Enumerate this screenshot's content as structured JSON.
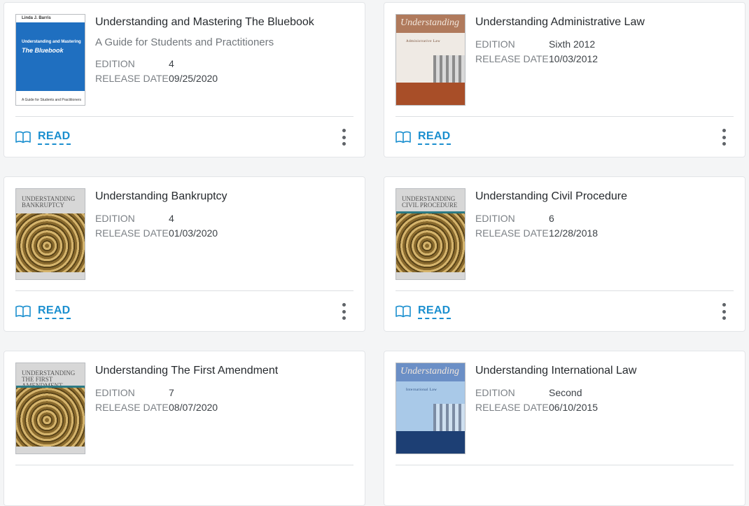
{
  "labels": {
    "edition": "EDITION",
    "release_date": "RELEASE DATE",
    "read": "READ"
  },
  "accent_color": "#1b8fcf",
  "books": [
    {
      "title": "Understanding and Mastering The Bluebook",
      "subtitle": "A Guide for Students and Practitioners",
      "edition": "4",
      "release_date": "09/25/2020",
      "cover_style": "blue",
      "cover_text": [
        "Linda J. Barris",
        "Understanding and Mastering",
        "The Bluebook",
        "A Guide for Students and Practitioners"
      ]
    },
    {
      "title": "Understanding Administrative Law",
      "edition": "Sixth 2012",
      "release_date": "10/03/2012",
      "cover_style": "admin",
      "cover_text": [
        "Understanding",
        "Administrative Law"
      ]
    },
    {
      "title": "Understanding Bankruptcy",
      "edition": "4",
      "release_date": "01/03/2020",
      "cover_style": "gray",
      "cover_text": [
        "UNDERSTANDING",
        "BANKRUPTCY"
      ]
    },
    {
      "title": "Understanding Civil Procedure",
      "edition": "6",
      "release_date": "12/28/2018",
      "cover_style": "gray",
      "cover_text": [
        "UNDERSTANDING",
        "CIVIL PROCEDURE"
      ]
    },
    {
      "title": "Understanding The First Amendment",
      "edition": "7",
      "release_date": "08/07/2020",
      "cover_style": "gray",
      "cover_text": [
        "UNDERSTANDING",
        "THE FIRST AMENDMENT"
      ]
    },
    {
      "title": "Understanding International Law",
      "edition": "Second",
      "release_date": "06/10/2015",
      "cover_style": "intl",
      "cover_text": [
        "Understanding",
        "International Law"
      ]
    }
  ]
}
